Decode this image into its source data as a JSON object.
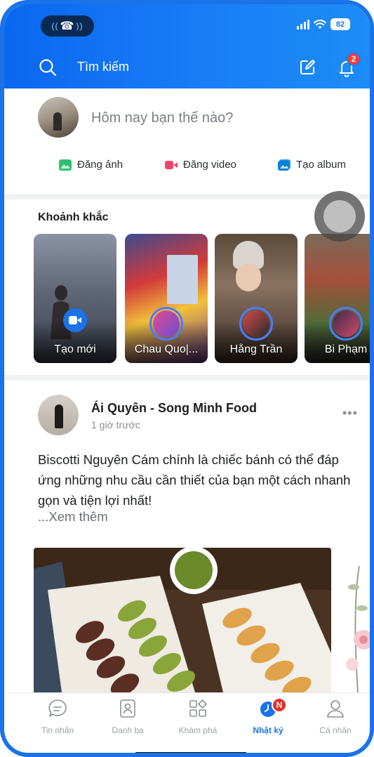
{
  "status_bar": {
    "battery": "82"
  },
  "search": {
    "placeholder": "Tìm kiếm",
    "notification_count": "2"
  },
  "composer": {
    "prompt": "Hôm nay bạn thế nào?",
    "actions": [
      {
        "label": "Đăng ảnh",
        "icon": "photo-icon",
        "color": "#2fbf71"
      },
      {
        "label": "Đăng video",
        "icon": "video-icon",
        "color": "#f0466c"
      },
      {
        "label": "Tạo album",
        "icon": "album-icon",
        "color": "#1a9af0"
      }
    ]
  },
  "moments": {
    "title": "Khoảnh khắc",
    "items": [
      {
        "label": "Tạo mới"
      },
      {
        "label": "Chau Quo|..."
      },
      {
        "label": "Hằng Trần"
      },
      {
        "label": "Bi Phạm"
      }
    ]
  },
  "post": {
    "author": "Ái Quyên - Song Minh Food",
    "time": "1 giờ trước",
    "text": "Biscotti Nguyên Cám chính là chiếc bánh có thể đáp ứng những nhu cầu cần thiết của bạn một cách nhanh gọn và tiện lợi nhất!",
    "see_more": "...Xem thêm"
  },
  "bottom_nav": {
    "items": [
      {
        "label": "Tin nhắn"
      },
      {
        "label": "Danh bạ"
      },
      {
        "label": "Khám phá"
      },
      {
        "label": "Nhật ký",
        "badge": "N"
      },
      {
        "label": "Cá nhân"
      }
    ],
    "active_color": "#1a73e8"
  },
  "colors": {
    "brand": "#1a73e8",
    "badge": "#ff3b30"
  }
}
